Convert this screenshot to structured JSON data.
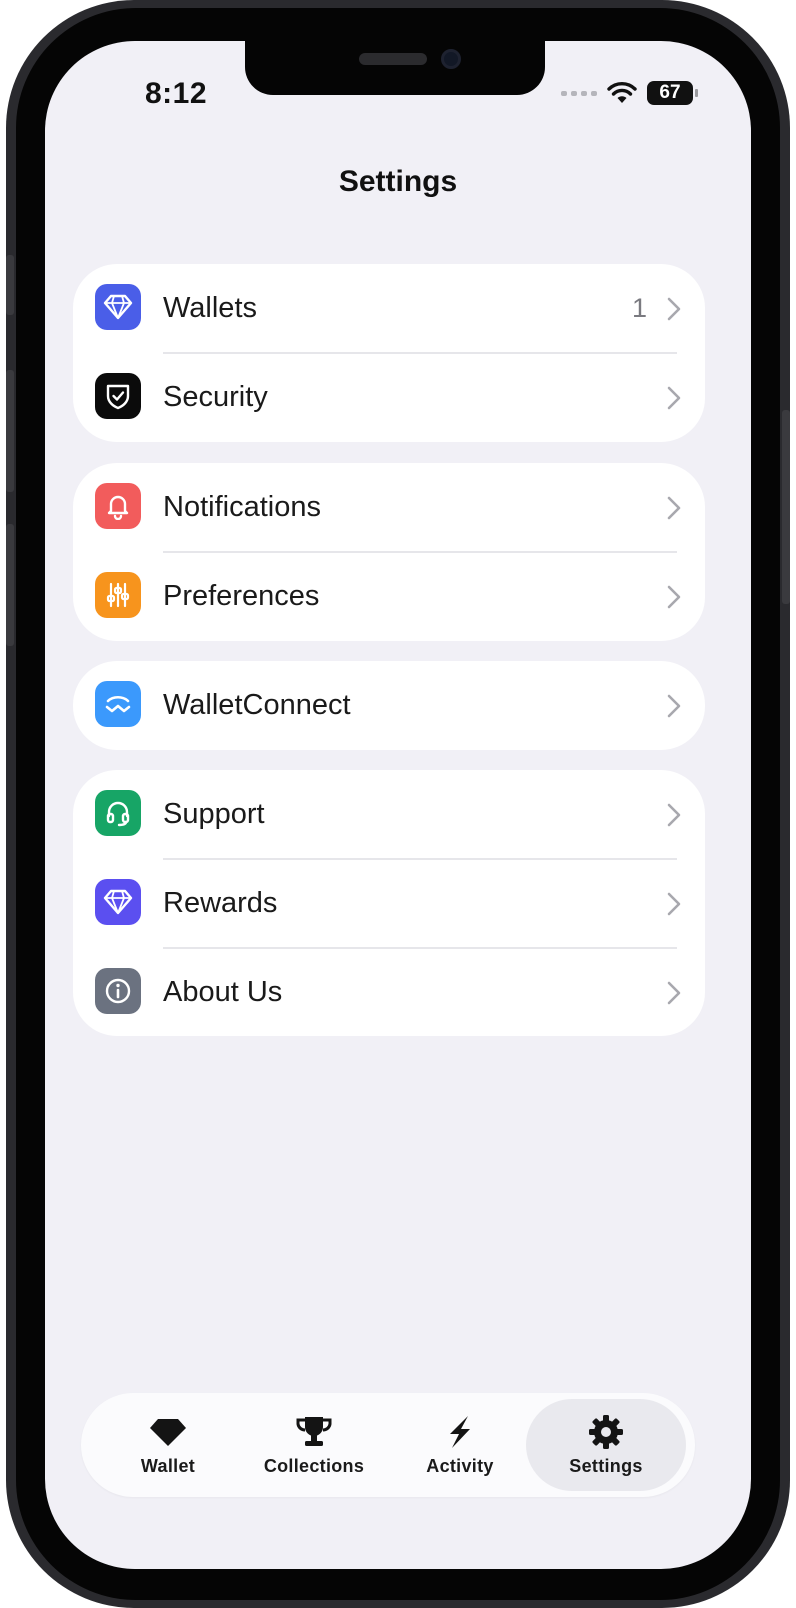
{
  "status_bar": {
    "time": "8:12",
    "battery": "67"
  },
  "header": {
    "title": "Settings"
  },
  "groups": [
    {
      "items": [
        {
          "label": "Wallets",
          "count": "1",
          "icon": "diamond-icon",
          "color": "#4a5ee8"
        },
        {
          "label": "Security",
          "icon": "shield-check-icon",
          "color": "#0b0b0b"
        }
      ]
    },
    {
      "items": [
        {
          "label": "Notifications",
          "icon": "bell-icon",
          "color": "#f25c5c"
        },
        {
          "label": "Preferences",
          "icon": "sliders-icon",
          "color": "#f7941d"
        }
      ]
    },
    {
      "items": [
        {
          "label": "WalletConnect",
          "icon": "walletconnect-icon",
          "color": "#3b99fc"
        }
      ]
    },
    {
      "items": [
        {
          "label": "Support",
          "icon": "headset-icon",
          "color": "#17a566"
        },
        {
          "label": "Rewards",
          "icon": "diamond-icon",
          "color": "#5b4ff0"
        },
        {
          "label": "About Us",
          "icon": "info-icon",
          "color": "#6b7280"
        }
      ]
    }
  ],
  "tabbar": {
    "tabs": [
      {
        "label": "Wallet",
        "icon": "gem-icon"
      },
      {
        "label": "Collections",
        "icon": "trophy-icon"
      },
      {
        "label": "Activity",
        "icon": "lightning-icon"
      },
      {
        "label": "Settings",
        "icon": "gear-icon",
        "active": true
      }
    ]
  }
}
